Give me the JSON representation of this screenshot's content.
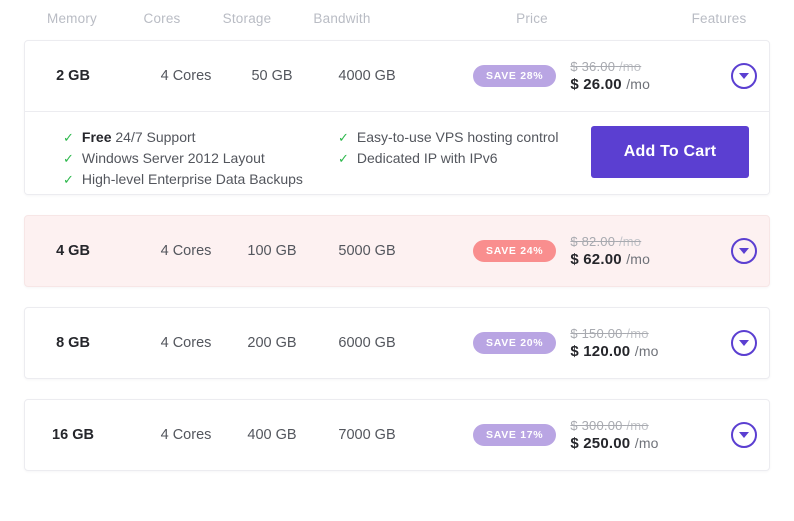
{
  "colors": {
    "accent_purple": "#5b3fd1",
    "badge_purple": "#b9a5e3",
    "badge_pink": "#f98e8e",
    "highlight_row_bg": "#fdf1f1",
    "check_green": "#2db84c"
  },
  "table": {
    "headers": {
      "memory": "Memory",
      "cores": "Cores",
      "storage": "Storage",
      "bandwith": "Bandwith",
      "price": "Price",
      "features": "Features"
    },
    "plans": [
      {
        "memory": "2 GB",
        "cores": "4 Cores",
        "storage": "50 GB",
        "bandwith": "4000 GB",
        "badge": "SAVE 28%",
        "badge_color": "#b9a5e3",
        "old_price": "$ 36.00",
        "old_price_period": "/mo",
        "new_price": "$ 26.00",
        "new_price_period": "/mo",
        "expander_icon": "chevron-down-circle-icon",
        "expanded": true,
        "highlighted": false,
        "features_col_1": [
          {
            "bold": "Free",
            "text": " 24/7 Support"
          },
          {
            "bold": "",
            "text": "Windows Server 2012 Layout"
          },
          {
            "bold": "",
            "text": "High-level Enterprise Data Backups"
          }
        ],
        "features_col_2": [
          {
            "bold": "",
            "text": "Easy-to-use VPS hosting control"
          },
          {
            "bold": "",
            "text": "Dedicated IP with IPv6"
          }
        ],
        "cart_label": "Add To Cart"
      },
      {
        "memory": "4 GB",
        "cores": "4 Cores",
        "storage": "100 GB",
        "bandwith": "5000 GB",
        "badge": "SAVE 24%",
        "badge_color": "#f98e8e",
        "old_price": "$ 82.00",
        "old_price_period": "/mo",
        "new_price": "$ 62.00",
        "new_price_period": "/mo",
        "expander_icon": "chevron-down-circle-icon",
        "expanded": false,
        "highlighted": true
      },
      {
        "memory": "8 GB",
        "cores": "4 Cores",
        "storage": "200 GB",
        "bandwith": "6000 GB",
        "badge": "SAVE 20%",
        "badge_color": "#b9a5e3",
        "old_price": "$ 150.00",
        "old_price_period": "/mo",
        "new_price": "$ 120.00",
        "new_price_period": "/mo",
        "expander_icon": "chevron-down-circle-icon",
        "expanded": false,
        "highlighted": false
      },
      {
        "memory": "16 GB",
        "cores": "4 Cores",
        "storage": "400 GB",
        "bandwith": "7000 GB",
        "badge": "SAVE 17%",
        "badge_color": "#b9a5e3",
        "old_price": "$ 300.00",
        "old_price_period": "/mo",
        "new_price": "$ 250.00",
        "new_price_period": "/mo",
        "expander_icon": "chevron-down-circle-icon",
        "expanded": false,
        "highlighted": false
      }
    ]
  }
}
